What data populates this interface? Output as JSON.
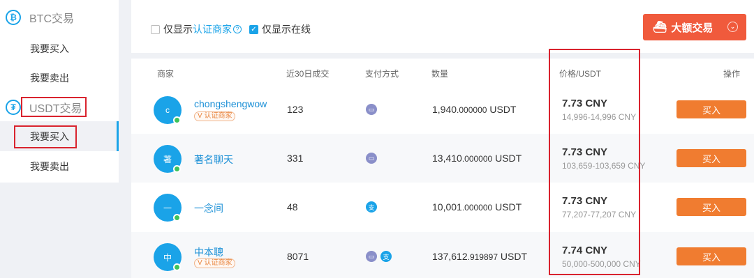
{
  "sidebar": {
    "btc": {
      "icon": "bitcoin-icon",
      "glyph": "₿",
      "title": "BTC交易",
      "buy": "我要买入",
      "sell": "我要卖出"
    },
    "usdt": {
      "icon": "tether-icon",
      "glyph": "₮",
      "title": "USDT交易",
      "buy": "我要买入",
      "sell": "我要卖出"
    }
  },
  "filters": {
    "certified_prefix": "仅显示",
    "certified_link": "认证商家",
    "certified_checked": false,
    "online_label": "仅显示在线",
    "online_checked": true
  },
  "big_trade": {
    "label": "大额交易",
    "icon": "ship-icon"
  },
  "table": {
    "headers": {
      "merchant": "商家",
      "trades_30d": "近30日成交",
      "payment": "支付方式",
      "quantity": "数量",
      "price": "价格/USDT",
      "action": "操作"
    },
    "badge_label": "认证商家",
    "buy_label": "买入",
    "rows": [
      {
        "avatar": "c",
        "name": "chongshengwow",
        "certified": true,
        "trades": "123",
        "payments": [
          "card"
        ],
        "qty_int": "1,940",
        "qty_dec": ".000000",
        "qty_unit": "USDT",
        "price": "7.73 CNY",
        "limit": "14,996-14,996 CNY"
      },
      {
        "avatar": "著",
        "name": "著名聊天",
        "certified": false,
        "trades": "331",
        "payments": [
          "card"
        ],
        "qty_int": "13,410",
        "qty_dec": ".000000",
        "qty_unit": "USDT",
        "price": "7.73 CNY",
        "limit": "103,659-103,659 CNY"
      },
      {
        "avatar": "一",
        "name": "一念间",
        "certified": false,
        "trades": "48",
        "payments": [
          "alipay"
        ],
        "qty_int": "10,001",
        "qty_dec": ".000000",
        "qty_unit": "USDT",
        "price": "7.73 CNY",
        "limit": "77,207-77,207 CNY"
      },
      {
        "avatar": "中",
        "name": "中本聰",
        "certified": true,
        "trades": "8071",
        "payments": [
          "card",
          "alipay"
        ],
        "qty_int": "137,612",
        "qty_dec": ".919897",
        "qty_unit": "USDT",
        "price": "7.74 CNY",
        "limit": "50,000-500,000 CNY"
      }
    ]
  },
  "colors": {
    "accent": "#1aa3e8",
    "buy": "#f07c30",
    "big_trade": "#f05a3c",
    "highlight": "#d9232e",
    "online": "#3cc35a"
  }
}
